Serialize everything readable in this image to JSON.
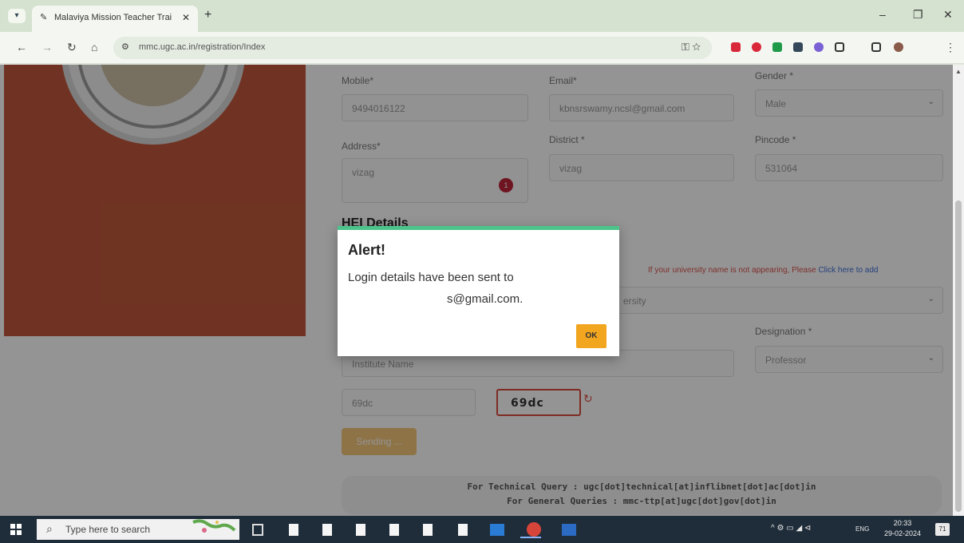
{
  "browser": {
    "tab_title": "Malaviya Mission Teacher Trai",
    "tab_close": "✕",
    "new_tab": "+",
    "url": "mmc.ugc.ac.in/registration/Index",
    "window_controls": {
      "minimize": "–",
      "restore": "❐",
      "close": "✕"
    }
  },
  "form": {
    "mobile": {
      "label": "Mobile*",
      "value": "9494016122"
    },
    "email": {
      "label": "Email*",
      "value": "kbnsrswamy.ncsl@gmail.com"
    },
    "gender": {
      "label": "Gender *",
      "value": "Male"
    },
    "address": {
      "label": "Address*",
      "value": "vizag",
      "badge": "1"
    },
    "district": {
      "label": "District *",
      "value": "vizag"
    },
    "pincode": {
      "label": "Pincode *",
      "value": "531064"
    },
    "hei_section_title": "HEI Details",
    "university_note": "If your university name is not appearing, Please",
    "university_note_link": "Click here to add",
    "university_value": "ersity",
    "designation": {
      "label": "Designation *",
      "value": "Professor"
    },
    "institute_placeholder": "Institute Name",
    "captcha_input_value": "69dc",
    "captcha_text": "69dc",
    "submit_label": "Sending ...",
    "footer_line1": "For Technical Query : ugc[dot]technical[at]inflibnet[dot]ac[dot]in",
    "footer_line2": "For General Queries : mmc-ttp[at]ugc[dot]gov[dot]in"
  },
  "dialog": {
    "title": "Alert!",
    "line1": "Login details have been sent to",
    "line2": "s@gmail.com.",
    "ok_label": "OK",
    "accent_color": "#4cc38a",
    "button_color": "#f2a51f"
  },
  "taskbar": {
    "search_placeholder": "Type here to search",
    "lang": "ENG",
    "time": "20:33",
    "date": "29-02-2024",
    "notifications": "71"
  },
  "colors": {
    "left_panel": "#c1593d"
  }
}
